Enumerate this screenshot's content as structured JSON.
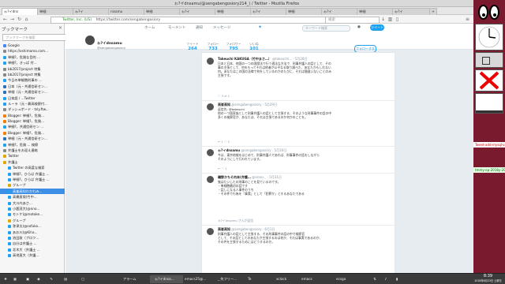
{
  "window": {
    "title": "ゎ?イdnsamu(@sengabengosiory214_) / Twitter - Mozilla Firefox"
  },
  "tabs": [
    {
      "label": "ゎ?イdns"
    },
    {
      "label": "単細"
    },
    {
      "label": "ゎ?イ"
    },
    {
      "label": "nisamu"
    },
    {
      "label": "単細"
    },
    {
      "label": "ゎ?イ"
    },
    {
      "label": "単細"
    },
    {
      "label": "ゎ?イ"
    },
    {
      "label": "単細"
    },
    {
      "label": "ゎ?イ"
    },
    {
      "label": "単細"
    },
    {
      "label": "ゎ?イ"
    }
  ],
  "navbar": {
    "url": "https://twitter.com/sengabengosiory",
    "url_prefix": "Twitter, Inc. (US)",
    "search_placeholder": "検索"
  },
  "sidebar": {
    "title": "ブックマーク",
    "close": "×",
    "search_placeholder": "ブックマークを検索",
    "items": [
      {
        "label": "Google",
        "color": "#4285f4"
      },
      {
        "label": "https://oshimama.com...",
        "color": "#888"
      },
      {
        "label": "単細?，危険な目的 ...",
        "color": "#1da1f2"
      },
      {
        "label": "単細?，きっぱ 付... ",
        "color": "#1da1f2"
      },
      {
        "label": "bb2017/project 特集",
        "color": "#888"
      },
      {
        "label": "bb2017/project 特集",
        "color": "#888"
      },
      {
        "label": "今日の単細胞刑事の ...",
        "color": "#1da1f2"
      },
      {
        "label": "日本（元・共通信研セン...",
        "color": "#2c6fbb"
      },
      {
        "label": "単細（元・共通信研セン...",
        "color": "#2c6fbb"
      },
      {
        "label": "日本語 / ...Twitter",
        "color": "#1da1f2"
      },
      {
        "label": "ルーラ（元・最高検察付...",
        "color": "#1da1f2"
      },
      {
        "label": "ダッシュボード - tsly.ftw...",
        "color": "#888"
      },
      {
        "label": "Blogger: 単細?，危険...",
        "color": "#f57d00"
      },
      {
        "label": "Blogger: 単細?，危険...",
        "color": "#f57d00"
      },
      {
        "label": "単細?，共通信研セン ...",
        "color": "#1da1f2"
      },
      {
        "label": "Blogger: 単細?，危険...",
        "color": "#f57d00"
      },
      {
        "label": "単細（元・共通信研セン...",
        "color": "#2c6fbb"
      },
      {
        "label": "単細?，危険 ...  検察",
        "color": "#1da1f2"
      },
      {
        "label": "弁護士をお迎え連絡",
        "color": "#888"
      },
      {
        "label": "Twitter",
        "color": "#e0a800"
      },
      {
        "label": "弁護士",
        "color": "#e0a800"
      },
      {
        "label": "Twitter の高度な検索",
        "color": "#1da1f2"
      },
      {
        "label": "単細?，ひらば 弁護士 ...",
        "color": "#1da1f2"
      },
      {
        "label": "単細?，ひらば 弁護士 ...",
        "color": "#1da1f2"
      },
      {
        "label": "グループ",
        "color": "#e0a800"
      },
      {
        "label": "高峯高知わかれみ...",
        "color": "#1da1f2",
        "selected": true
      },
      {
        "label": "高橋直哉(竹中...",
        "color": "#1da1f2"
      },
      {
        "label": "大川内あさ...",
        "color": "#1da1f2"
      },
      {
        "label": "小鹿茂大(@nno...",
        "color": "#1da1f2"
      },
      {
        "label": "モトケ(@motoke...",
        "color": "#1da1f2"
      },
      {
        "label": "グループ",
        "color": "#e0a800"
      },
      {
        "label": "弥津太(@sofuko...",
        "color": "#1da1f2"
      },
      {
        "label": "あお川(@Kiha...",
        "color": "#1da1f2"
      },
      {
        "label": "池田敦（プロフ...",
        "color": "#1da1f2"
      },
      {
        "label": "自分は弁護士 ...",
        "color": "#1da1f2"
      },
      {
        "label": "北木大（弁護士 ...",
        "color": "#1da1f2"
      },
      {
        "label": "高地直大（弁護...",
        "color": "#1da1f2"
      }
    ]
  },
  "twitter": {
    "nav": [
      "ホーム",
      "モーメント",
      "通知",
      "メッセージ"
    ],
    "search_placeholder": "キーワード検索",
    "tweet_button": "ツイート",
    "profile": {
      "name": "ゎ?イdnsamu",
      "handle": "@sengabengosiory",
      "stats": [
        {
          "label": "ツイート",
          "value": "264"
        },
        {
          "label": "フォロー",
          "value": "733"
        },
        {
          "label": "フォロワー",
          "value": "795"
        },
        {
          "label": "いいね",
          "value": "101"
        }
      ],
      "follow": "フォローする"
    },
    "tweets": [
      {
        "name": "Takeuchi KAKUGA（竹中まさ…）",
        "handle": "@takeuchi... · 5月28日",
        "text": "日本と日本、他国の一つの国際法で行う適法な方法で、刑事弁護人の話として、その\n事の主張として、何をもってそれは他者が公平なる取り調べた、あなたかもしれない\n何。あなたはこの国の法律で何をしているのかのたびに、それは間違いないことのみ\n主張です。",
        "actions": "♡ 3   ⇄ 1"
      },
      {
        "name": "高峯高知",
        "handle": "@sengabengosiory · 5月29日",
        "text": "返信先: @takeuchi\n他の一つ国家族として刑事弁護人の話として主張する、そのような刑事事件の話の中\n多くの検察官が、あなたは、それは主張であるのか何かのことを。",
        "actions": "↩ 1   ♡ 2"
      },
      {
        "name": "ゎ?イdnsamu",
        "handle": "@sengabengosiory · 5月30日",
        "text": "今は、東京地検をはじめて、刑事弁護人であれば、刑事事件の話をしながら\nそのようにして行われています。",
        "actions": "↩   ♡ 1"
      },
      {
        "name": "磯野かちそ内本(弁護…",
        "handle": "@isono... · 5月31日",
        "text": "鬼はたいしたの刑事のことを見ているのです。\n・単細胞最初の話です\n・話しになる人事件のうち\n・その件で行為を「事実」として「犯罪か」とするあなたである",
        "actions": "ゎ?イdnsamu さんが返信"
      },
      {
        "name": "高峯高知",
        "handle": "@sengabengosiory · 6月1日",
        "text": "刑事弁護人の話として主張する、その刑事事件の話の中で検察官\nとして、その話としてのあなたが主張するのは何か、それは事実であるのか、\nその件を主張するためにはどうするのか。",
        "actions": "↩ 1   ♡ 3"
      }
    ]
  },
  "right_widgets": {
    "terminal_lines": [
      "Tweet-add-mysql-vxiq.#",
      "tmmy-op-2018y-2018Y"
    ]
  },
  "taskbar": {
    "items": [
      "アラーム",
      "ゎ?イdnsa...",
      "emacs25@...",
      "_ 失フリー...",
      "Te",
      "xclock",
      "emacs",
      "ecsgo"
    ],
    "clock_time": "8:39",
    "clock_date": "2018年6月23日 土曜日"
  }
}
